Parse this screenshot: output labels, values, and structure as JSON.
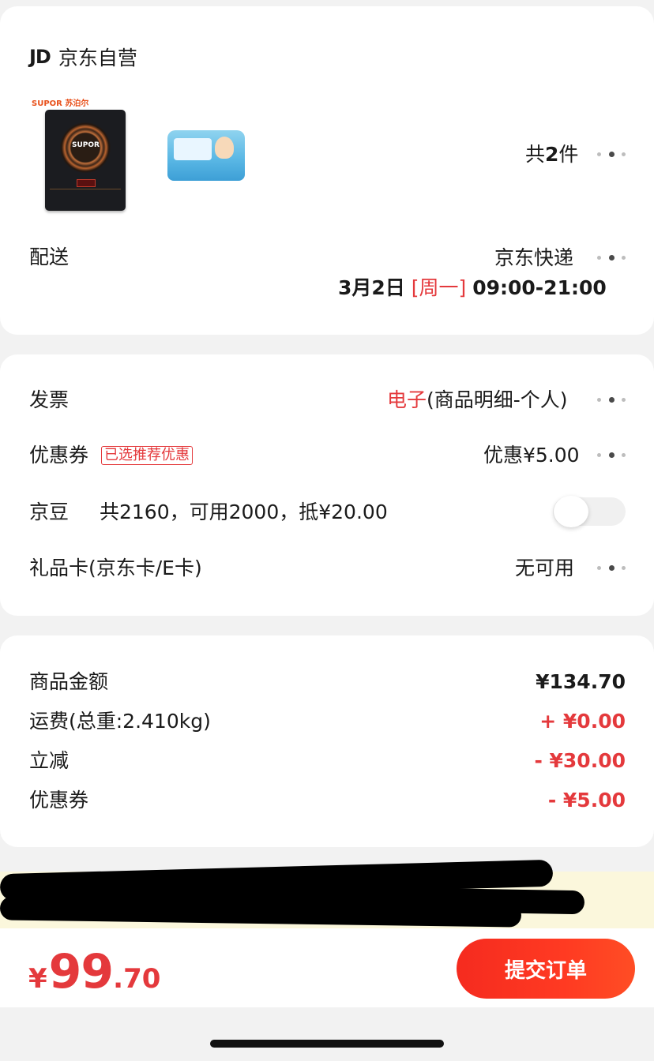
{
  "store": {
    "logo": "JD",
    "name": "京东自营"
  },
  "products": {
    "items": [
      {
        "brand": "SUPOR 苏泊尔",
        "label": "SUPOR",
        "icon": "induction-cooker-image"
      },
      {
        "icon": "baby-wipes-image"
      }
    ],
    "count_prefix": "共",
    "count": "2",
    "count_suffix": "件"
  },
  "delivery": {
    "label": "配送",
    "carrier": "京东快递",
    "date": "3月2日",
    "weekday": "[周一]",
    "time": "09:00-21:00"
  },
  "invoice": {
    "label": "发票",
    "type_red": "电子",
    "type_rest": "(商品明细-个人)"
  },
  "coupon": {
    "label": "优惠券",
    "tag": "已选推荐优惠",
    "value": "优惠¥5.00"
  },
  "jingdou": {
    "label": "京豆",
    "desc": "共2160，可用2000，抵¥20.00",
    "enabled": false
  },
  "gift_card": {
    "label": "礼品卡(京东卡/E卡)",
    "value": "无可用"
  },
  "summary": [
    {
      "label": "商品金额",
      "value": "¥134.70",
      "color": "#1a1a1a"
    },
    {
      "label": "运费(总重:2.410kg)",
      "value": "+ ¥0.00",
      "color": "#e4393c"
    },
    {
      "label": "立减",
      "value": "- ¥30.00",
      "color": "#e4393c"
    },
    {
      "label": "优惠券",
      "value": "- ¥5.00",
      "color": "#e4393c"
    }
  ],
  "footer": {
    "currency": "¥",
    "total_int": "99",
    "total_dec": ".70",
    "submit_label": "提交订单"
  },
  "colors": {
    "accent": "#e4393c",
    "button": "#f52b1f",
    "background": "#f2f2f2"
  }
}
